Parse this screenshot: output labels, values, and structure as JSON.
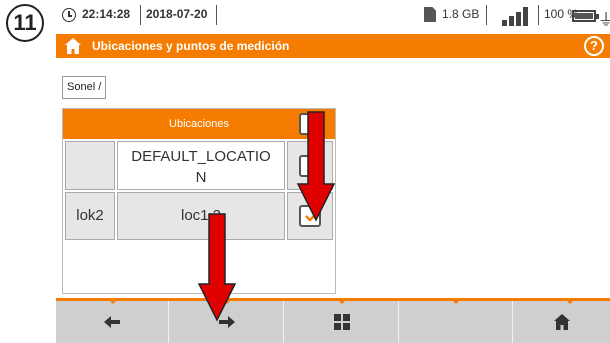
{
  "step_badge": "11",
  "status_bar": {
    "time": "22:14:28",
    "date": "2018-07-20",
    "storage": "1.8 GB",
    "battery_percent": "100 %",
    "icons": [
      "clock-icon",
      "sd-card-icon",
      "signal-bars-icon",
      "battery-icon",
      "plug-icon"
    ]
  },
  "title_bar": {
    "title": "Ubicaciones y puntos de medición",
    "help_label": "?",
    "accent_color": "#f57c00"
  },
  "breadcrumb": "Sonel /",
  "table": {
    "header": "Ubicaciones",
    "rows": [
      {
        "id": "",
        "name_line1": "DEFAULT_LOCATIO",
        "name_line2": "N",
        "checked": false
      },
      {
        "id": "lok2",
        "name": "loc1.2",
        "checked": true
      }
    ]
  },
  "toolbar": {
    "buttons": [
      "arrow-left-icon",
      "arrow-right-icon",
      "grid-icon",
      "",
      "home-icon"
    ]
  }
}
